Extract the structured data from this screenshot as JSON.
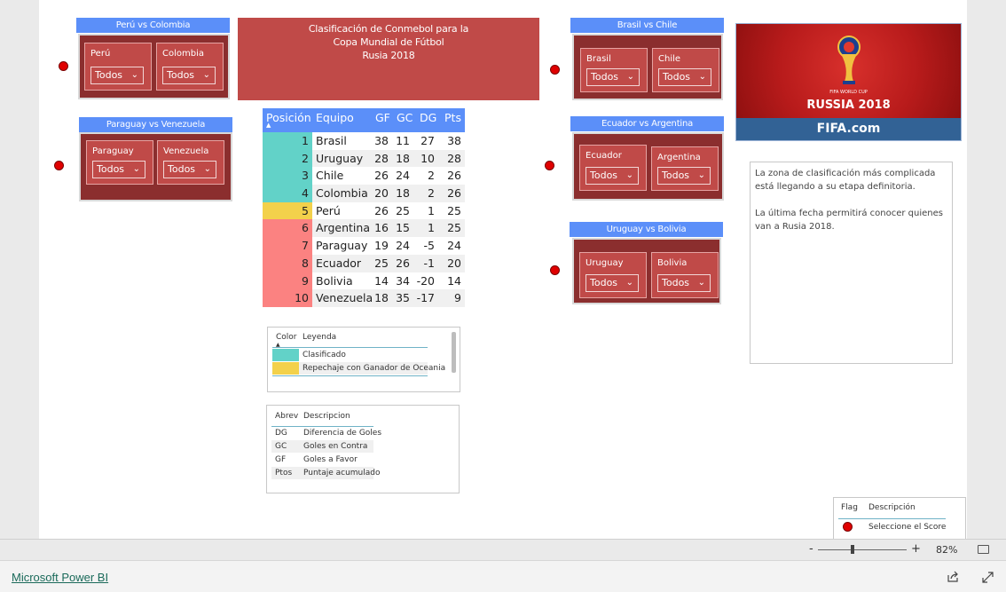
{
  "matches": {
    "peru_colombia": {
      "title": "Perú vs Colombia",
      "team_a": "Perú",
      "team_b": "Colombia",
      "value_a": "Todos",
      "value_b": "Todos"
    },
    "paraguay_venezuela": {
      "title": "Paraguay vs Venezuela",
      "team_a": "Paraguay",
      "team_b": "Venezuela",
      "value_a": "Todos",
      "value_b": "Todos"
    },
    "brasil_chile": {
      "title": "Brasil vs Chile",
      "team_a": "Brasil",
      "team_b": "Chile",
      "value_a": "Todos",
      "value_b": "Todos"
    },
    "ecuador_argentina": {
      "title": "Ecuador vs Argentina",
      "team_a": "Ecuador",
      "team_b": "Argentina",
      "value_a": "Todos",
      "value_b": "Todos"
    },
    "uruguay_bolivia": {
      "title": "Uruguay vs Bolivia",
      "team_a": "Uruguay",
      "team_b": "Bolivia",
      "value_a": "Todos",
      "value_b": "Todos"
    }
  },
  "header": {
    "line1": "Clasificación de Conmebol para la",
    "line2": "Copa Mundial de Fútbol",
    "line3": "Rusia 2018"
  },
  "standings": {
    "columns": [
      "Posición",
      "Equipo",
      "GF",
      "GC",
      "DG",
      "Pts"
    ],
    "rows": [
      {
        "pos": "1",
        "team": "Brasil",
        "gf": "38",
        "gc": "11",
        "dg": "27",
        "pts": "38",
        "color": "#62d2c8"
      },
      {
        "pos": "2",
        "team": "Uruguay",
        "gf": "28",
        "gc": "18",
        "dg": "10",
        "pts": "28",
        "color": "#62d2c8"
      },
      {
        "pos": "3",
        "team": "Chile",
        "gf": "26",
        "gc": "24",
        "dg": "2",
        "pts": "26",
        "color": "#62d2c8"
      },
      {
        "pos": "4",
        "team": "Colombia",
        "gf": "20",
        "gc": "18",
        "dg": "2",
        "pts": "26",
        "color": "#62d2c8"
      },
      {
        "pos": "5",
        "team": "Perú",
        "gf": "26",
        "gc": "25",
        "dg": "1",
        "pts": "25",
        "color": "#f3d14b"
      },
      {
        "pos": "6",
        "team": "Argentina",
        "gf": "16",
        "gc": "15",
        "dg": "1",
        "pts": "25",
        "color": "#fb8281"
      },
      {
        "pos": "7",
        "team": "Paraguay",
        "gf": "19",
        "gc": "24",
        "dg": "-5",
        "pts": "24",
        "color": "#fb8281"
      },
      {
        "pos": "8",
        "team": "Ecuador",
        "gf": "25",
        "gc": "26",
        "dg": "-1",
        "pts": "20",
        "color": "#fb8281"
      },
      {
        "pos": "9",
        "team": "Bolivia",
        "gf": "14",
        "gc": "34",
        "dg": "-20",
        "pts": "14",
        "color": "#fb8281"
      },
      {
        "pos": "10",
        "team": "Venezuela",
        "gf": "18",
        "gc": "35",
        "dg": "-17",
        "pts": "9",
        "color": "#fb8281"
      }
    ]
  },
  "color_legend": {
    "col_color": "Color",
    "col_legend": "Leyenda",
    "rows": [
      {
        "color": "#62d2c8",
        "label": "Clasificado"
      },
      {
        "color": "#f3d14b",
        "label": "Repechaje con Ganador de Oceania"
      }
    ]
  },
  "abbrev": {
    "col_abrev": "Abrev",
    "col_desc": "Descripcion",
    "rows": [
      {
        "abrev": "DG",
        "desc": "Diferencia de Goles"
      },
      {
        "abrev": "GC",
        "desc": "Goles en Contra"
      },
      {
        "abrev": "GF",
        "desc": "Goles a Favor"
      },
      {
        "abrev": "Ptos",
        "desc": "Puntaje acumulado"
      }
    ]
  },
  "fifa_image": {
    "cup_text": "FIFA WORLD CUP",
    "russia_text": "RUSSIA 2018",
    "footer": "FIFA.com"
  },
  "info_text": {
    "p1": "La zona de clasificación más complicada está llegando a su etapa definitoria.",
    "p2": "La última fecha permitirá conocer quienes van a Rusia 2018."
  },
  "flag_legend": {
    "col_flag": "Flag",
    "col_desc": "Descripción",
    "row_desc": "Seleccione el Score"
  },
  "zoom": {
    "minus": "-",
    "plus": "+",
    "level": "82%"
  },
  "footer": {
    "link": "Microsoft Power BI"
  },
  "colors": {
    "accent_blue": "#5b8ff9",
    "card_red": "#c04a48",
    "dark_red": "#8b2e2e",
    "dot_red": "#e00000"
  }
}
